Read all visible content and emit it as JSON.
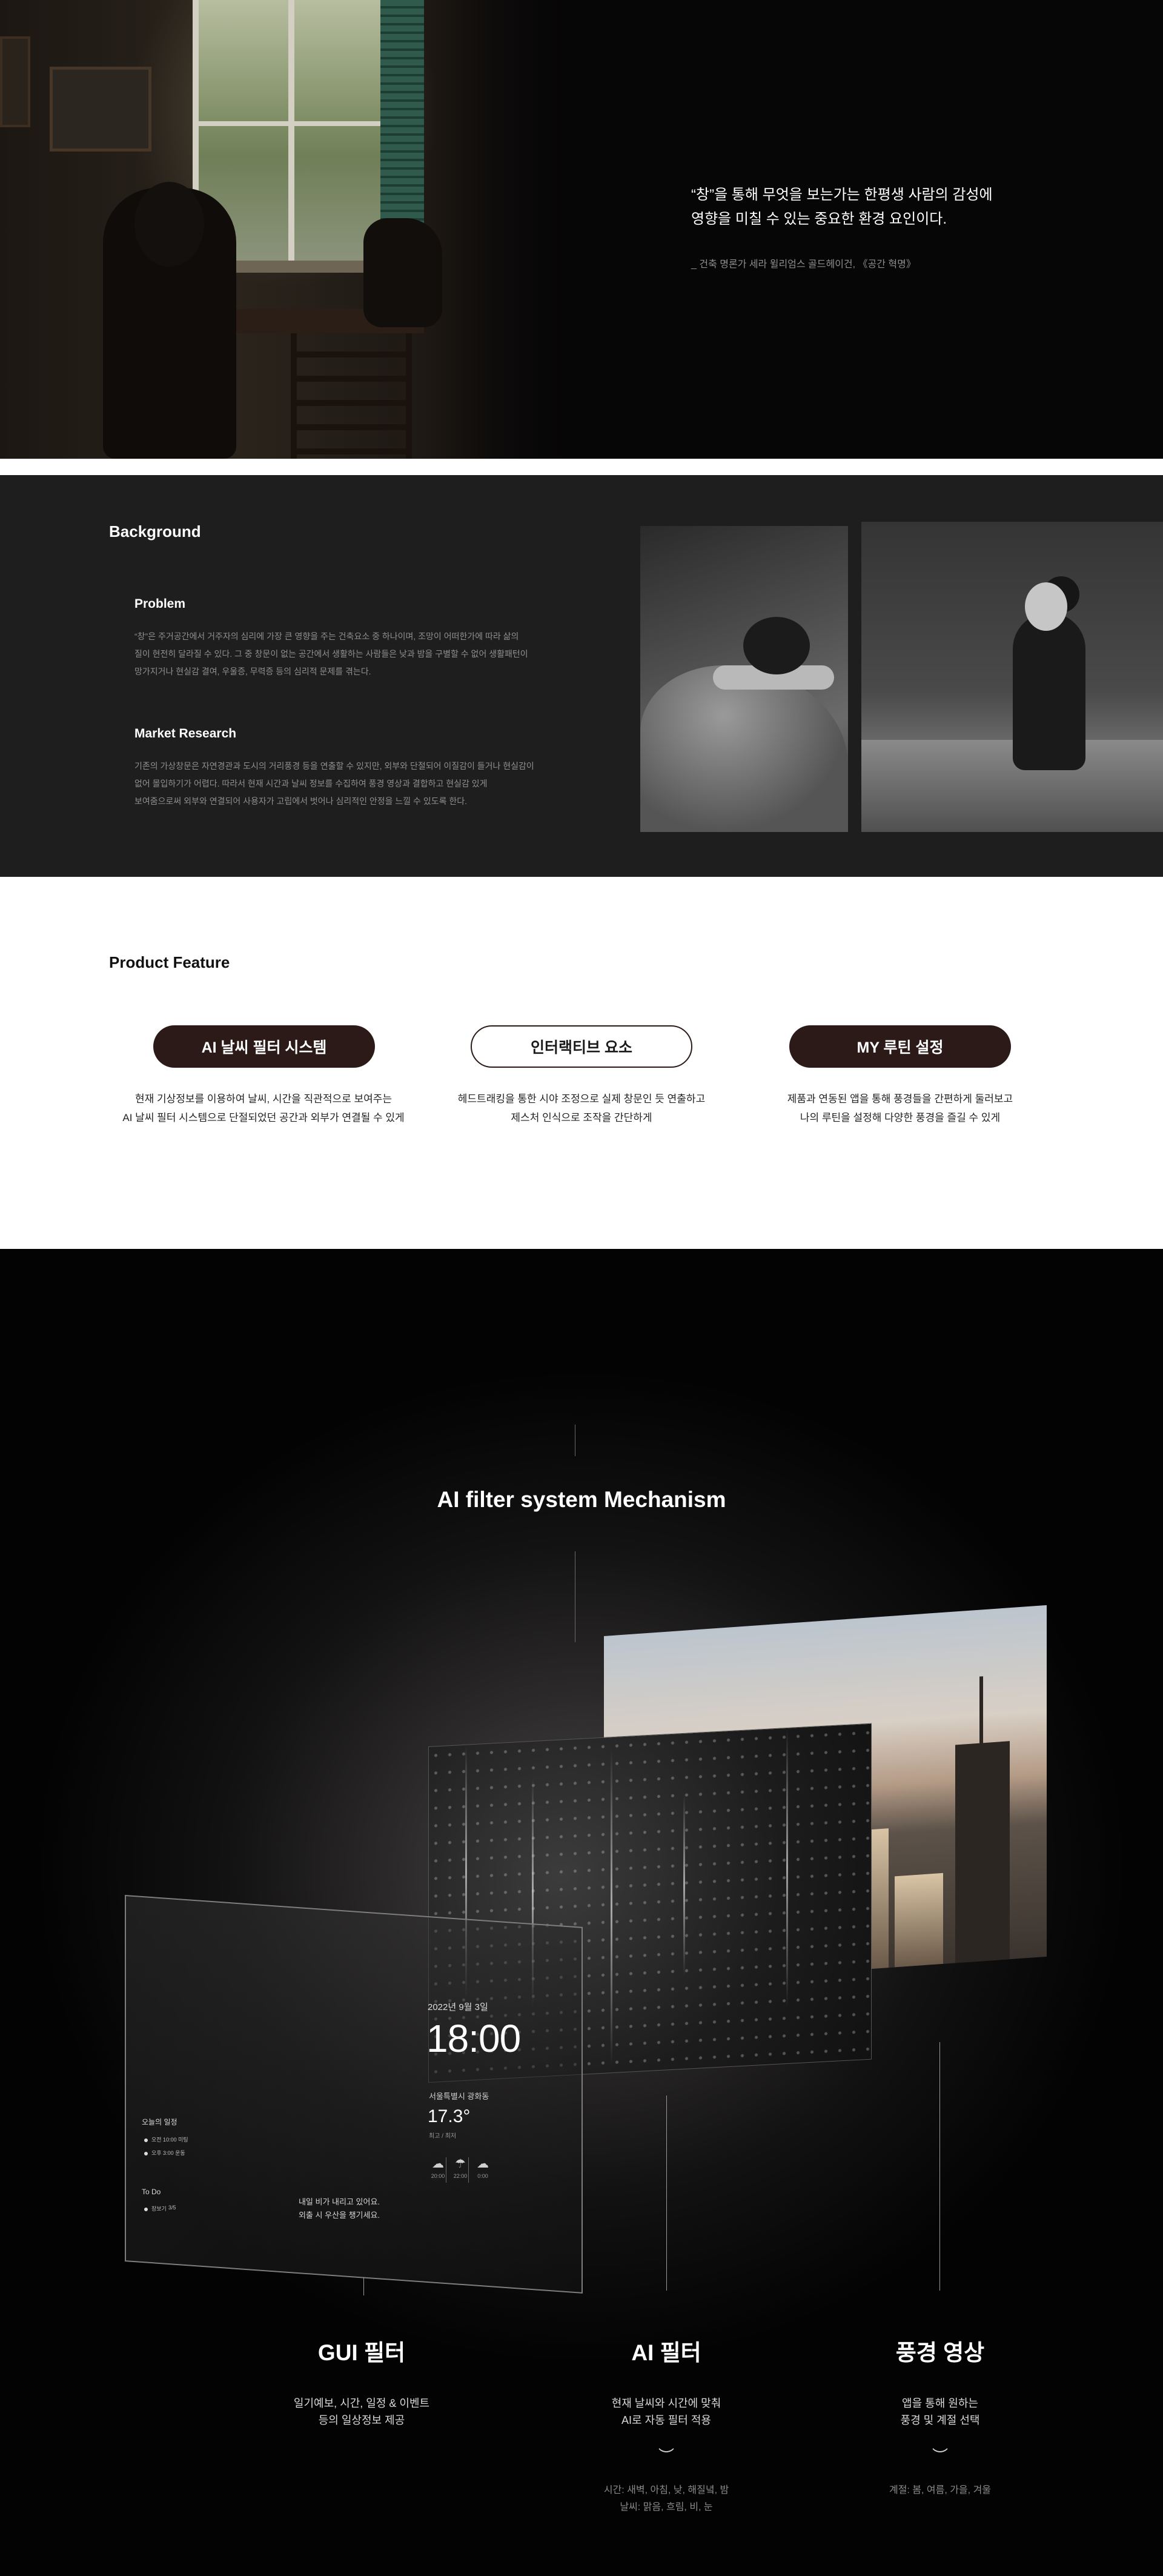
{
  "hero": {
    "quote_line1": "“창”을 통해 무엇을 보는가는 한평생 사람의 감성에",
    "quote_line2": "영향을 미칠 수 있는 중요한 환경 요인이다.",
    "source": "_ 건축 명론가 세라 윌리엄스 골드헤이건, 《공간 혁명》"
  },
  "background": {
    "title": "Background",
    "problem_title": "Problem",
    "problem_lines": [
      "“창”은 주거공간에서 거주자의 심리에 가장 큰 영향을 주는 건축요소 중 하나이며, 조망이 어떠한가에 따라 삶의",
      "질이 현전히 달라질 수 있다. 그 중 창문이 없는 공간에서 생활하는 사람들은 낮과 밤을 구별할 수 없어 생활패턴이",
      "망가지거나 현실감 결여, 우울증, 무력증 등의 심리적 문제를 겪는다."
    ],
    "market_title": "Market Research",
    "market_lines": [
      "기존의 가상창문은 자연경관과 도시의 거리풍경 등을 연출할 수 있지만, 외부와 단절되어 이질감이 들거나 현실감이",
      "없어 몰입하기가 어렵다. 따라서 현재 시간과 날씨 정보를 수집하여 풍경 영상과 결합하고 현실감 있게",
      "보여줌으로써 외부와 연결되어 사용자가 고립에서 벗어나 심리적인 안정을 느낄 수 있도록 한다."
    ]
  },
  "product_feature": {
    "title": "Product Feature",
    "features": [
      {
        "label": "AI 날씨 필터 시스템",
        "lines": [
          "현재 기상정보를 이용하여 날씨, 시간을 직관적으로 보여주는",
          "AI 날씨 필터 시스템으로 단절되었던 공간과 외부가 연결될 수 있게"
        ]
      },
      {
        "label": "인터랙티브 요소",
        "lines": [
          "헤드트래킹을 통한 시야 조정으로 실제 창문인 듯 연출하고",
          "제스처 인식으로 조작을 간단하게"
        ]
      },
      {
        "label": "MY 루틴 설정",
        "lines": [
          "제품과 연동된 앱을 통해 풍경들을 간편하게 둘러보고",
          "나의 루틴을 설정해 다양한 풍경을 즐길 수 있게"
        ]
      }
    ]
  },
  "mechanism": {
    "title": "AI filter system Mechanism",
    "ui": {
      "date": "2022년 9월 3일",
      "time": "18:00",
      "location": "서울특별시 광화동",
      "temperature": "17.3°",
      "temp_sub": "최고 / 최저",
      "weather": [
        {
          "icon": "☁",
          "label": "20:00"
        },
        {
          "icon": "☂",
          "label": "22:00"
        },
        {
          "icon": "☁",
          "label": "0:00"
        }
      ],
      "schedule_title": "오늘의 일정",
      "schedule_items": [
        "오전 10:00 미팅",
        "오후 3:00 운동"
      ],
      "todo_title": "To Do",
      "todo_item": "장보기",
      "todo_count": "3/5",
      "notice_line1": "내일 비가 내리고 있어요.",
      "notice_line2": "외출 시 우산을 챙기세요."
    },
    "columns": [
      {
        "heading": "GUI 필터",
        "lines": [
          "일기예보, 시간, 일정 & 이벤트",
          "등의 일상정보 제공"
        ],
        "chevron": "",
        "notes": []
      },
      {
        "heading": "AI 필터",
        "lines": [
          "현재 날씨와 시간에 맞춰",
          "AI로 자동 필터 적용"
        ],
        "chevron": "︶",
        "notes": [
          "시간: 새벽, 아침, 낮, 해질녘, 밤",
          "날씨: 맑음, 흐림, 비, 눈"
        ]
      },
      {
        "heading": "풍경 영상",
        "lines": [
          "앱을 통해 원하는",
          "풍경 및 계절 선택"
        ],
        "chevron": "︶",
        "notes": [
          "계절: 봄, 여름, 가을, 겨울"
        ]
      }
    ]
  }
}
